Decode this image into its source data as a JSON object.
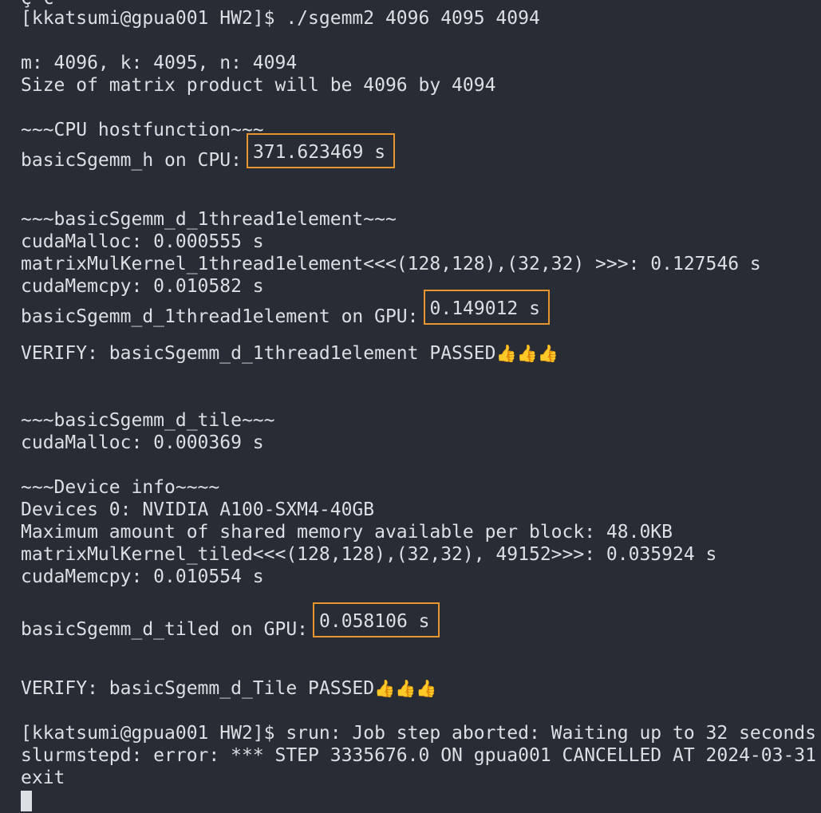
{
  "terminal": {
    "lines": [
      {
        "id": "top_cut",
        "text": "Ç €"
      },
      {
        "id": "cmd",
        "text": "[kkatsumi@gpua001 HW2]$ ./sgemm2 4096 4095 4094"
      },
      {
        "id": "dims",
        "text": "m: 4096, k: 4095, n: 4094"
      },
      {
        "id": "size",
        "text": "Size of matrix product will be 4096 by 4094"
      },
      {
        "id": "cpu_header",
        "text": "~~~CPU hostfunction~~~"
      },
      {
        "id": "cpu_result_label",
        "text": "basicSgemm_h on CPU:"
      },
      {
        "id": "cpu_result_value",
        "text": "371.623469 s"
      },
      {
        "id": "gpu1_header",
        "text": "~~~basicSgemm_d_1thread1element~~~"
      },
      {
        "id": "gpu1_malloc",
        "text": "cudaMalloc: 0.000555 s"
      },
      {
        "id": "gpu1_kernel",
        "text": "matrixMulKernel_1thread1element<<<(128,128),(32,32) >>>: 0.127546 s"
      },
      {
        "id": "gpu1_memcpy",
        "text": "cudaMemcpy: 0.010582 s"
      },
      {
        "id": "gpu1_result_label",
        "text": "basicSgemm_d_1thread1element on GPU:"
      },
      {
        "id": "gpu1_result_value",
        "text": "0.149012 s"
      },
      {
        "id": "gpu1_verify",
        "text": "VERIFY: basicSgemm_d_1thread1element PASSED"
      },
      {
        "id": "gpu1_verify_emoji",
        "text": "👍👍👍"
      },
      {
        "id": "tile_header",
        "text": "~~~basicSgemm_d_tile~~~"
      },
      {
        "id": "tile_malloc",
        "text": "cudaMalloc: 0.000369 s"
      },
      {
        "id": "device_header",
        "text": "~~~Device info~~~~"
      },
      {
        "id": "device_name",
        "text": "Devices 0: NVIDIA A100-SXM4-40GB"
      },
      {
        "id": "device_shmem",
        "text": "Maximum amount of shared memory available per block: 48.0KB"
      },
      {
        "id": "tile_kernel",
        "text": "matrixMulKernel_tiled<<<(128,128),(32,32), 49152>>>: 0.035924 s"
      },
      {
        "id": "tile_memcpy",
        "text": "cudaMemcpy: 0.010554 s"
      },
      {
        "id": "tile_result_label",
        "text": "basicSgemm_d_tiled on GPU:"
      },
      {
        "id": "tile_result_value",
        "text": "0.058106 s"
      },
      {
        "id": "tile_verify",
        "text": "VERIFY: basicSgemm_d_Tile PASSED"
      },
      {
        "id": "tile_verify_emoji",
        "text": "👍👍👍"
      },
      {
        "id": "srun_msg",
        "text": "[kkatsumi@gpua001 HW2]$ srun: Job step aborted: Waiting up to 32 seconds"
      },
      {
        "id": "slurm_err",
        "text": "slurmstepd: error: *** STEP 3335676.0 ON gpua001 CANCELLED AT 2024-03-31"
      },
      {
        "id": "exit",
        "text": "exit"
      }
    ]
  },
  "colors": {
    "background": "#282c34",
    "foreground": "#dcdfe4",
    "highlight_box": "#e8952e"
  }
}
